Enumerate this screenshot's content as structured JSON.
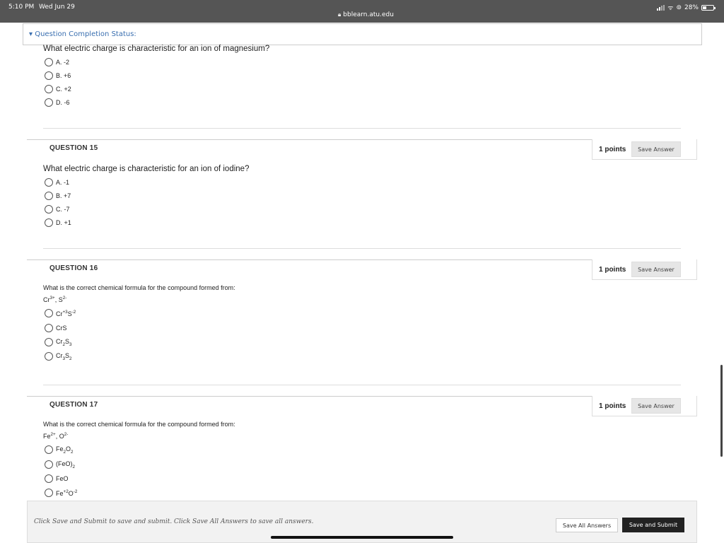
{
  "statusbar": {
    "time": "5:10 PM",
    "date": "Wed Jun 29",
    "url": "bblearn.atu.edu",
    "battery": "28%"
  },
  "status_section": {
    "label": "Question Completion Status:"
  },
  "q14": {
    "question": "What electric charge is characteristic for an ion of magnesium?",
    "options": [
      "A. -2",
      "B. +6",
      "C. +2",
      "D. -6"
    ]
  },
  "q15": {
    "title": "QUESTION 15",
    "points": "1 points",
    "save": "Save Answer",
    "question": "What electric charge is characteristic for an ion of iodine?",
    "options": [
      "A. -1",
      "B. +7",
      "C. -7",
      "D. +1"
    ]
  },
  "q16": {
    "title": "QUESTION 16",
    "points": "1 points",
    "save": "Save Answer",
    "question": "What is the correct chemical formula for the compound formed from:",
    "ions": {
      "a": "Cr",
      "a_sup": "3+",
      "sep": ", S",
      "b_sup": "2-"
    },
    "options": {
      "o1": {
        "a": "Cr",
        "a_sup": "+3",
        "b": "S",
        "b_sup": "-2"
      },
      "o2": "CrS",
      "o3": {
        "a": "Cr",
        "a_sub": "2",
        "b": "S",
        "b_sub": "3"
      },
      "o4": {
        "a": "Cr",
        "a_sub": "3",
        "b": "S",
        "b_sub": "2"
      }
    }
  },
  "q17": {
    "title": "QUESTION 17",
    "points": "1 points",
    "save": "Save Answer",
    "question": "What is the correct chemical formula for the compound formed from:",
    "ions": {
      "a": "Fe",
      "a_sup": "2+",
      "sep": ", O",
      "b_sup": "2-"
    },
    "options": {
      "o1": {
        "a": "Fe",
        "a_sub": "2",
        "b": "O",
        "b_sub": "2"
      },
      "o2": {
        "a": "(FeO)",
        "a_sub": "2"
      },
      "o3": "FeO",
      "o4": {
        "a": "Fe",
        "a_sup": "+2",
        "b": "O",
        "b_sup": "-2"
      }
    }
  },
  "footer": {
    "note": "Click Save and Submit to save and submit. Click Save All Answers to save all answers.",
    "save_all": "Save All Answers",
    "submit": "Save and Submit"
  }
}
